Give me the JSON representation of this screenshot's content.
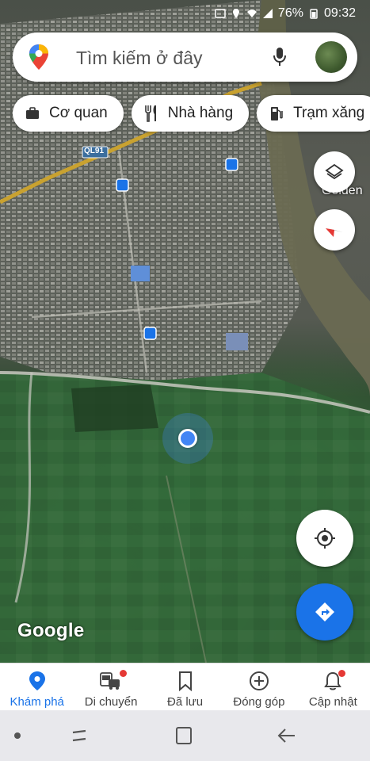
{
  "status_bar": {
    "battery_percent": "76%",
    "clock": "09:32"
  },
  "search": {
    "placeholder": "Tìm kiếm ở đây",
    "pin_icon": "google-maps-pin-icon",
    "mic_icon": "mic-icon"
  },
  "chips": [
    {
      "label": "Cơ quan",
      "icon": "briefcase-icon"
    },
    {
      "label": "Nhà hàng",
      "icon": "fork-knife-icon"
    },
    {
      "label": "Trạm xăng",
      "icon": "gas-pump-icon"
    }
  ],
  "map": {
    "road_label": "QL91",
    "place_label": "Golden",
    "attribution": "Google"
  },
  "bottom_nav": [
    {
      "label": "Khám phá",
      "icon": "explore-pin-icon",
      "active": true,
      "badge": false
    },
    {
      "label": "Di chuyển",
      "icon": "commute-icon",
      "active": false,
      "badge": true
    },
    {
      "label": "Đã lưu",
      "icon": "bookmark-icon",
      "active": false,
      "badge": false
    },
    {
      "label": "Đóng góp",
      "icon": "add-circle-icon",
      "active": false,
      "badge": false
    },
    {
      "label": "Cập nhật",
      "icon": "bell-icon",
      "active": false,
      "badge": true
    }
  ],
  "colors": {
    "accent": "#1a73e8",
    "badge": "#e53935",
    "location": "#4285f4"
  }
}
